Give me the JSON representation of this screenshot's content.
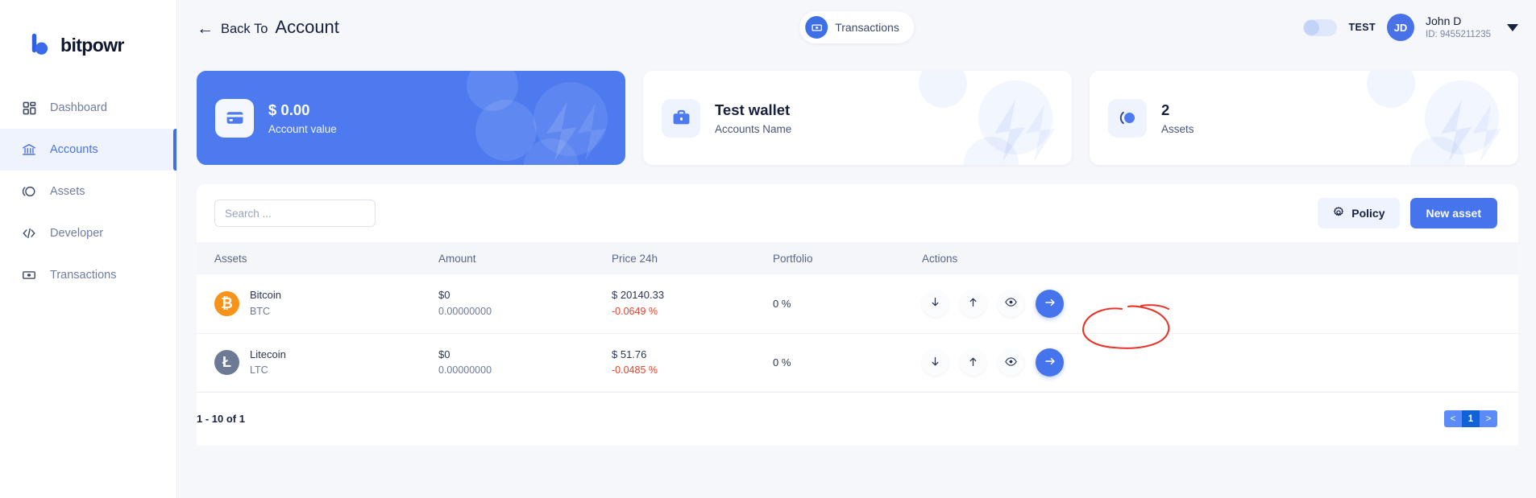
{
  "brand": {
    "name": "bitpowr"
  },
  "sidebar": {
    "items": [
      {
        "label": "Dashboard",
        "icon": "grid-icon",
        "active": false
      },
      {
        "label": "Accounts",
        "icon": "bank-icon",
        "active": true
      },
      {
        "label": "Assets",
        "icon": "assets-icon",
        "active": false
      },
      {
        "label": "Developer",
        "icon": "code-icon",
        "active": false
      },
      {
        "label": "Transactions",
        "icon": "banknote-icon",
        "active": false
      }
    ]
  },
  "header": {
    "back_prefix": "Back To",
    "back_title": "Account",
    "back_arrow_icon": "arrow-left-icon",
    "transactions_pill": {
      "label": "Transactions",
      "icon": "banknote-icon"
    },
    "toggle": {
      "state": "off",
      "label": "TEST"
    },
    "user": {
      "initials": "JD",
      "name": "John D",
      "id": "ID: 9455211235"
    },
    "caret_icon": "chevron-down-icon"
  },
  "cards": [
    {
      "value": "$ 0.00",
      "sub": "Account value",
      "icon": "credit-card-icon",
      "primary": true
    },
    {
      "value": "Test wallet",
      "sub": "Accounts Name",
      "icon": "briefcase-icon",
      "primary": false
    },
    {
      "value": "2",
      "sub": "Assets",
      "icon": "assets-icon",
      "primary": false
    }
  ],
  "toolbar": {
    "search_placeholder": "Search ...",
    "search_value": "",
    "policy_label": "Policy",
    "policy_icon": "gear-icon",
    "new_asset_label": "New asset"
  },
  "table": {
    "columns": [
      "Assets",
      "Amount",
      "Price 24h",
      "Portfolio",
      "Actions"
    ],
    "rows": [
      {
        "coin_name": "Bitcoin",
        "coin_symbol": "BTC",
        "coin_glyph": "₿",
        "coin_color": "#f7931a",
        "amount_usd": "$0",
        "amount_crypto": "0.00000000",
        "price": "$ 20140.33",
        "change": "-0.0649 %",
        "portfolio": "0 %",
        "actions": [
          "arrow-down-icon",
          "arrow-up-icon",
          "eye-icon",
          "arrow-right-icon"
        ]
      },
      {
        "coin_name": "Litecoin",
        "coin_symbol": "LTC",
        "coin_glyph": "Ł",
        "coin_color": "#6c7a96",
        "amount_usd": "$0",
        "amount_crypto": "0.00000000",
        "price": "$ 51.76",
        "change": "-0.0485 %",
        "portfolio": "0 %",
        "actions": [
          "arrow-down-icon",
          "arrow-up-icon",
          "eye-icon",
          "arrow-right-icon"
        ]
      }
    ]
  },
  "pagination": {
    "info": "1 - 10 of 1",
    "prev": "<",
    "current": "1",
    "next": ">"
  },
  "colors": {
    "accent": "#4574ec",
    "primary_card": "#4d7bef",
    "page_bg": "#f5f7fb",
    "negative": "#e8402a",
    "bitcoin": "#f7931a",
    "litecoin": "#6c7a96",
    "annotation": "#e8342a"
  },
  "annotation": {
    "shape": "hand-drawn-circle",
    "target": "send-button-row-1"
  }
}
